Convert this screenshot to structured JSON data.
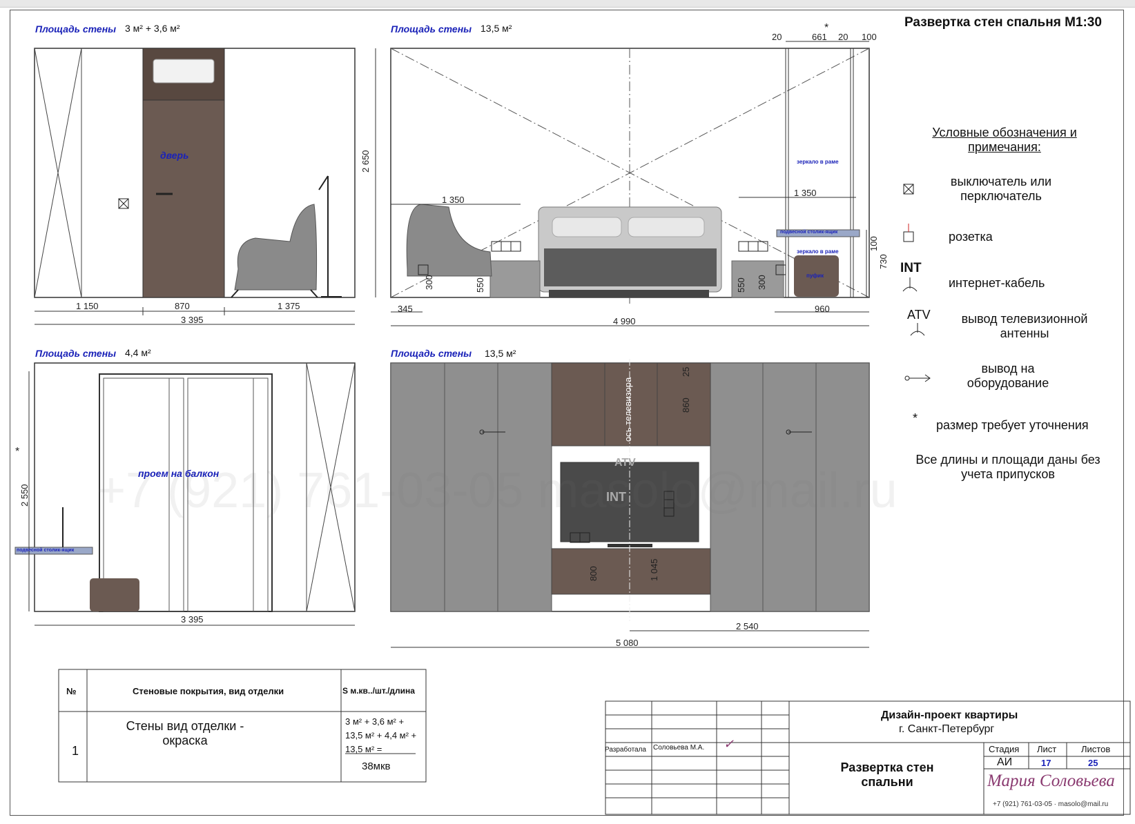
{
  "title": "Развертка стен спальня",
  "scale": "М1:30",
  "walls": {
    "w1": {
      "area_label": "Площадь стены",
      "area_value": "3 м² + 3,6 м²",
      "door_label": "дверь",
      "dims": [
        "1 150",
        "870",
        "1 375"
      ],
      "total": "3 395"
    },
    "w2": {
      "area_label": "Площадь стены",
      "area_value": "13,5 м²",
      "height": "2 650",
      "dims_top": [
        "20",
        "661",
        "20",
        "100"
      ],
      "star": "*",
      "d1350a": "1 350",
      "d1350b": "1 350",
      "d300a": "300",
      "d550a": "550",
      "d550b": "550",
      "d300b": "300",
      "d345": "345",
      "total": "4 990",
      "d960": "960",
      "d100": "100",
      "d730": "730",
      "mirror1": "зеркало в раме",
      "mirror2": "зеркало в раме",
      "lamp": "подвесной столик-ящик",
      "pouf": "пуфик"
    },
    "w3": {
      "area_label": "Площадь стены",
      "area_value": "4,4 м²",
      "opening_label": "проем на балкон",
      "height": "2 550",
      "star": "*",
      "lamp": "подвесной столик-ящик",
      "total": "3 395"
    },
    "w4": {
      "area_label": "Площадь стены",
      "area_value": "13,5 м²",
      "tv_axis": "ось телевизора",
      "atv": "ATV",
      "int": "INT",
      "d25": "25",
      "d860": "860",
      "d800": "800",
      "d1045": "1 045",
      "d2540": "2 540",
      "total": "5 080"
    }
  },
  "legend": {
    "heading": "Условные обозначения и примечания:",
    "items": [
      {
        "symbol": "switch",
        "label": "выключатель или перключатель"
      },
      {
        "symbol": "socket",
        "label": "розетка"
      },
      {
        "symbol": "INT",
        "label": "интернет-кабель"
      },
      {
        "symbol": "ATV",
        "label": "вывод телевизионной антенны"
      },
      {
        "symbol": "arrow",
        "label": "вывод на оборудование"
      },
      {
        "symbol": "*",
        "label": "размер требует уточнения"
      }
    ],
    "note": "Все длины и площади даны без учета припусков"
  },
  "finish_table": {
    "headers": [
      "№",
      "Стеновые покрытия, вид отделки",
      "S м.кв../шт./длина"
    ],
    "rows": [
      {
        "num": "1",
        "desc": "Стены вид отделки - окраска",
        "calc_lines": [
          "3 м² + 3,6 м² +",
          "13,5 м² + 4,4 м² +",
          "13,5 м² ="
        ],
        "total": "38мкв"
      }
    ]
  },
  "title_block": {
    "project": "Дизайн-проект квартиры",
    "city": "г. Санкт-Петербург",
    "role": "Разработала",
    "author": "Соловьева М.А.",
    "sheet_title": "Развертка стен спальни",
    "stage_h": "Стадия",
    "sheet_h": "Лист",
    "sheets_h": "Листов",
    "stage": "АИ",
    "sheet": "17",
    "sheets": "25",
    "brand": "Мария Соловьева",
    "contact": "+7 (921) 761-03-05 · masolo@mail.ru"
  },
  "watermark": "+7 (921) 761-03-05   masolo@mail.ru"
}
